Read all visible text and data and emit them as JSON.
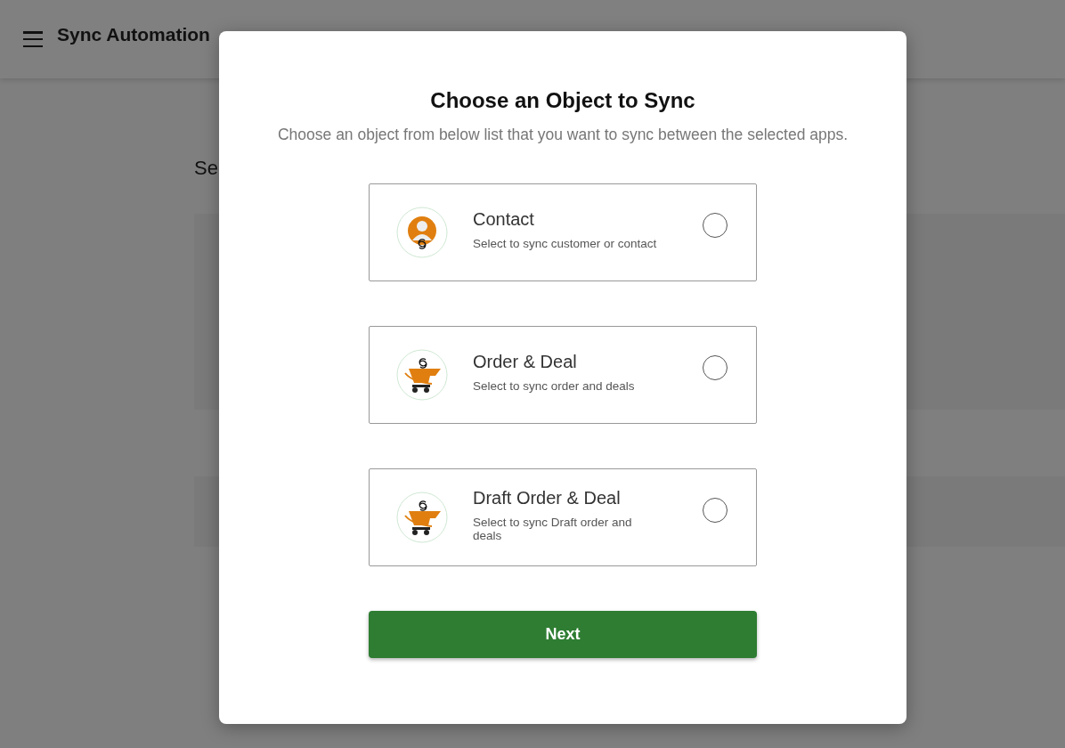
{
  "header": {
    "title": "Sync Automation"
  },
  "page": {
    "heading": "Se"
  },
  "modal": {
    "title": "Choose an Object to Sync",
    "subtitle": "Choose an object from below list that you want to sync between the selected apps.",
    "options": [
      {
        "kind": "person",
        "name": "Contact",
        "description": "Select to sync customer or contact",
        "selected": false
      },
      {
        "kind": "cart",
        "name": "Order & Deal",
        "description": "Select to sync order and deals",
        "selected": false
      },
      {
        "kind": "cart",
        "name": "Draft Order & Deal",
        "description": "Select to sync Draft order and deals",
        "selected": false
      }
    ],
    "button": "Next"
  }
}
